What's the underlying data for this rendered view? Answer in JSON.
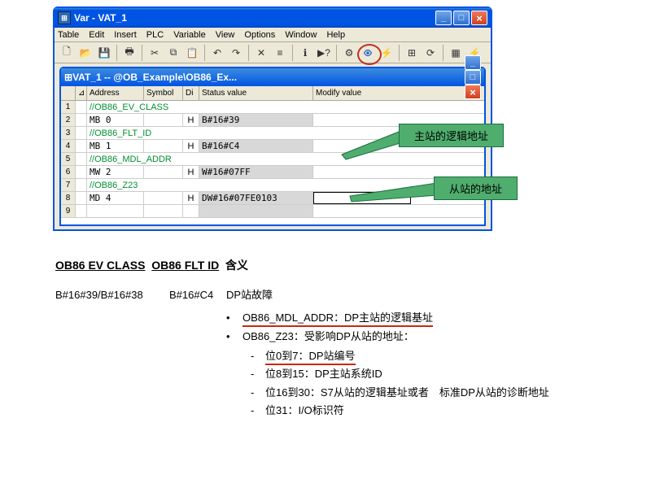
{
  "outer_window": {
    "title": "Var - VAT_1",
    "menu": [
      "Table",
      "Edit",
      "Insert",
      "PLC",
      "Variable",
      "View",
      "Options",
      "Window",
      "Help"
    ]
  },
  "inner_window": {
    "title": "VAT_1 -- @OB_Example\\OB86_Ex...",
    "columns": {
      "rownum": "",
      "marker": "",
      "addr": "Address",
      "sym": "Symbol",
      "disp": "Di",
      "status": "Status value",
      "modify": "Modify value"
    },
    "rows": [
      {
        "num": "1",
        "comment": true,
        "addr": "//OB86_EV_CLASS"
      },
      {
        "num": "2",
        "addr": "MB   0",
        "disp": "H",
        "status": "B#16#39"
      },
      {
        "num": "3",
        "comment": true,
        "addr": "//OB86_FLT_ID"
      },
      {
        "num": "4",
        "addr": "MB   1",
        "disp": "H",
        "status": "B#16#C4"
      },
      {
        "num": "5",
        "comment": true,
        "addr": "//OB86_MDL_ADDR"
      },
      {
        "num": "6",
        "addr": "MW   2",
        "disp": "H",
        "status": "W#16#07FF"
      },
      {
        "num": "7",
        "comment": true,
        "addr": "//OB86_Z23"
      },
      {
        "num": "8",
        "addr": "MD   4",
        "disp": "H",
        "status": "DW#16#07FE0103",
        "selected": true
      },
      {
        "num": "9",
        "addr": "",
        "disp": "",
        "status": ""
      }
    ]
  },
  "callouts": {
    "c1": "主站的逻辑地址",
    "c2": "从站的地址"
  },
  "doc": {
    "title_parts": {
      "p1": "OB86 EV CLASS",
      "p2": "OB86 FLT ID",
      "p3": "含义"
    },
    "row1": {
      "col1": "B#16#39/B#16#38",
      "col2": "B#16#C4",
      "col3": "DP站故障"
    },
    "bullets": {
      "b1": "OB86_MDL_ADDR：DP主站的逻辑基址",
      "b2": "OB86_Z23：受影响DP从站的地址："
    },
    "subs": {
      "s1": "位0到7：DP站编号",
      "s2": "位8到15：DP主站系统ID",
      "s3": "位16到30：S7从站的逻辑基址或者　标准DP从站的诊断地址",
      "s4": "位31：I/O标识符"
    }
  }
}
